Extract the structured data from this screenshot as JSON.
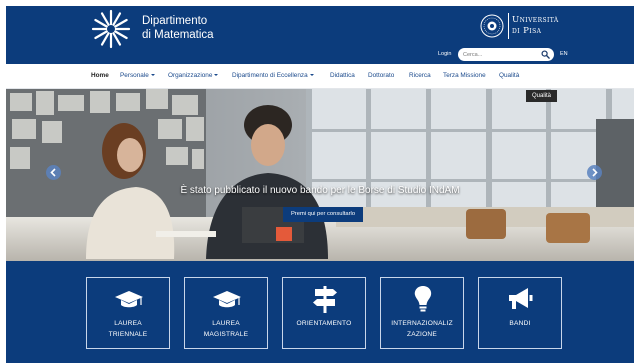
{
  "header": {
    "dept_name_line1": "Dipartimento",
    "dept_name_line2": "di Matematica",
    "university_line1": "Università",
    "university_line2": "di Pisa",
    "login_label": "Login",
    "search_placeholder": "Cerca...",
    "language_label": "EN"
  },
  "nav": {
    "items": [
      {
        "label": "Home"
      },
      {
        "label": "Personale"
      },
      {
        "label": "Organizzazione"
      },
      {
        "label": "Dipartimento di Eccellenza"
      },
      {
        "label": "Didattica"
      },
      {
        "label": "Dottorato"
      },
      {
        "label": "Ricerca"
      },
      {
        "label": "Terza Missione"
      },
      {
        "label": "Qualità"
      }
    ]
  },
  "hero": {
    "badge": "Qualità",
    "caption": "È stato pubblicato il nuovo bando per le Borse di Studio INdAM",
    "cta_label": "Premi qui per consultarlo"
  },
  "quick_links": [
    {
      "line1": "LAUREA",
      "line2": "TRIENNALE",
      "icon": "graduation-cap-icon"
    },
    {
      "line1": "LAUREA",
      "line2": "MAGISTRALE",
      "icon": "graduation-cap-icon"
    },
    {
      "line1": "ORIENTAMENTO",
      "line2": "",
      "icon": "signpost-icon"
    },
    {
      "line1": "INTERNAZIONALIZ",
      "line2": "ZAZIONE",
      "icon": "lightbulb-icon"
    },
    {
      "line1": "BANDI",
      "line2": "",
      "icon": "megaphone-icon"
    }
  ],
  "colors": {
    "brand_blue": "#0c3c7c",
    "white": "#ffffff"
  }
}
